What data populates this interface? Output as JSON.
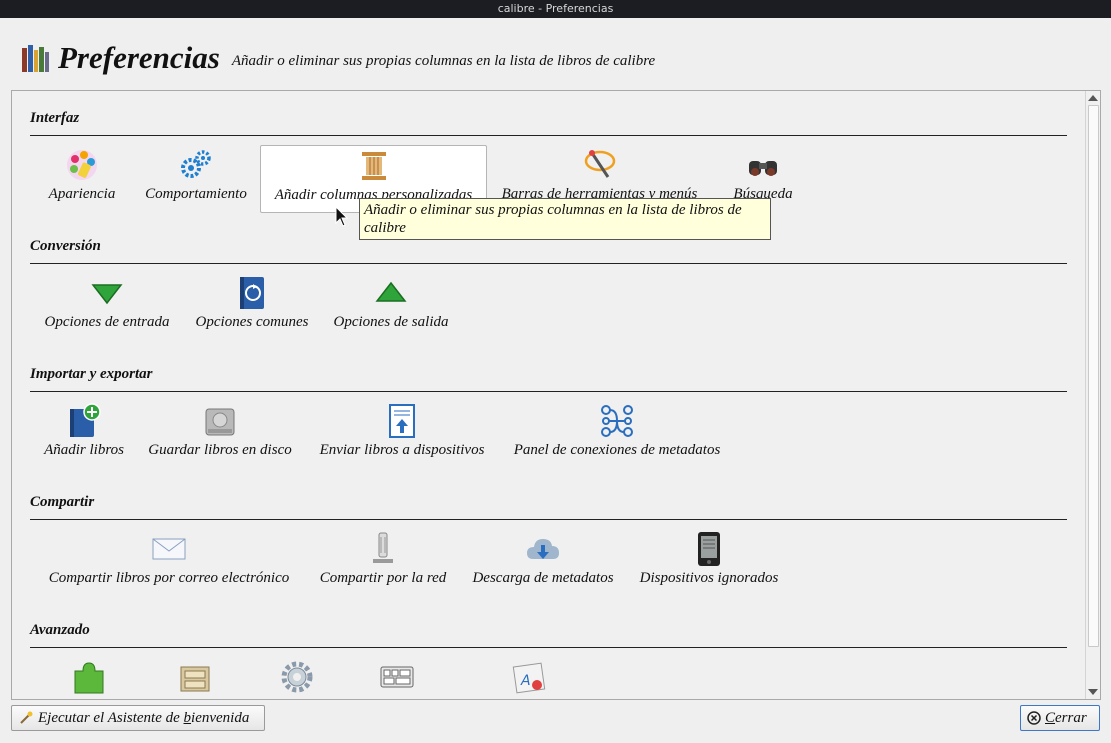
{
  "window": {
    "title": "calibre - Preferencias"
  },
  "header": {
    "title": "Preferencias",
    "subtitle": "Añadir o eliminar sus propias columnas en la lista de libros de calibre",
    "logo_icon": "calibre-library-icon"
  },
  "sections": [
    {
      "title": "Interfaz",
      "items": [
        {
          "label": "Apariencia",
          "icon": "palette-icon"
        },
        {
          "label": "Comportamiento",
          "icon": "gears-icon"
        },
        {
          "label": "Añadir columnas personalizadas",
          "icon": "column-icon",
          "selected": true
        },
        {
          "label": "Barras de herramientas y menús",
          "icon": "toolbar-wand-icon"
        },
        {
          "label": "Búsqueda",
          "icon": "binoculars-icon"
        }
      ]
    },
    {
      "title": "Conversión",
      "items": [
        {
          "label": "Opciones de entrada",
          "icon": "arrow-down-icon"
        },
        {
          "label": "Opciones comunes",
          "icon": "book-convert-icon"
        },
        {
          "label": "Opciones de salida",
          "icon": "arrow-up-icon"
        }
      ]
    },
    {
      "title": "Importar y exportar",
      "items": [
        {
          "label": "Añadir libros",
          "icon": "add-book-icon"
        },
        {
          "label": "Guardar libros en disco",
          "icon": "hard-disk-icon"
        },
        {
          "label": "Enviar libros a dispositivos",
          "icon": "send-document-icon"
        },
        {
          "label": "Panel de conexiones de metadatos",
          "icon": "plugboard-icon"
        }
      ]
    },
    {
      "title": "Compartir",
      "items": [
        {
          "label": "Compartir libros por correo electrónico",
          "icon": "envelope-icon"
        },
        {
          "label": "Compartir por la red",
          "icon": "network-server-icon"
        },
        {
          "label": "Descarga de metadatos",
          "icon": "cloud-download-icon"
        },
        {
          "label": "Dispositivos ignorados",
          "icon": "ereader-icon"
        }
      ]
    },
    {
      "title": "Avanzado",
      "items": [
        {
          "label": "",
          "icon": "plugin-puzzle-icon"
        },
        {
          "label": "",
          "icon": "cabinet-icon"
        },
        {
          "label": "",
          "icon": "gear-icon"
        },
        {
          "label": "",
          "icon": "keyboard-icon"
        },
        {
          "label": "",
          "icon": "template-icon"
        }
      ]
    }
  ],
  "tooltip": {
    "text": "Añadir o eliminar sus propias columnas en la lista de libros de calibre"
  },
  "footer": {
    "wizard_button": {
      "prefix": "Ejecutar el Asistente de ",
      "underlined": "b",
      "suffix": "ienvenida"
    },
    "close_button": {
      "underlined": "C",
      "suffix": "errar"
    }
  },
  "colors": {
    "accent": "#3b78c8",
    "tooltip_bg": "#ffffdc"
  }
}
